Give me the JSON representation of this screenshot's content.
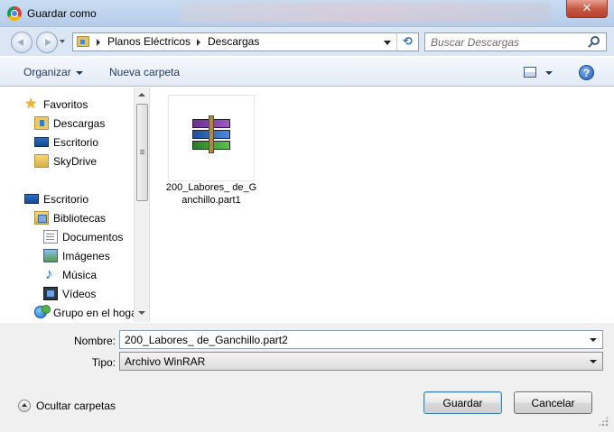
{
  "window": {
    "title": "Guardar como",
    "close_label": "✕"
  },
  "address": {
    "breadcrumb": [
      "Planos Eléctricos",
      "Descargas"
    ],
    "search_placeholder": "Buscar Descargas"
  },
  "toolbar": {
    "organize_label": "Organizar",
    "new_folder_label": "Nueva carpeta",
    "help_label": "?"
  },
  "sidebar": {
    "items": [
      {
        "label": "Favoritos",
        "icon": "star-icon"
      },
      {
        "label": "Descargas",
        "icon": "downloads-folder-icon"
      },
      {
        "label": "Escritorio",
        "icon": "desktop-icon"
      },
      {
        "label": "SkyDrive",
        "icon": "folder-icon"
      },
      {
        "label": "Escritorio",
        "icon": "desktop-icon"
      },
      {
        "label": "Bibliotecas",
        "icon": "library-icon"
      },
      {
        "label": "Documentos",
        "icon": "documents-icon"
      },
      {
        "label": "Imágenes",
        "icon": "pictures-icon"
      },
      {
        "label": "Música",
        "icon": "music-icon"
      },
      {
        "label": "Vídeos",
        "icon": "videos-icon"
      },
      {
        "label": "Grupo en el hoga",
        "icon": "homegroup-icon"
      }
    ]
  },
  "files": [
    {
      "name": "200_Labores_ de_Ganchillo.part1",
      "icon": "winrar-archive-icon"
    }
  ],
  "form": {
    "name_label": "Nombre:",
    "name_value": "200_Labores_ de_Ganchillo.part2",
    "type_label": "Tipo:",
    "type_value": "Archivo WinRAR"
  },
  "footer": {
    "hide_folders_label": "Ocultar carpetas",
    "save_label": "Guardar",
    "cancel_label": "Cancelar"
  }
}
